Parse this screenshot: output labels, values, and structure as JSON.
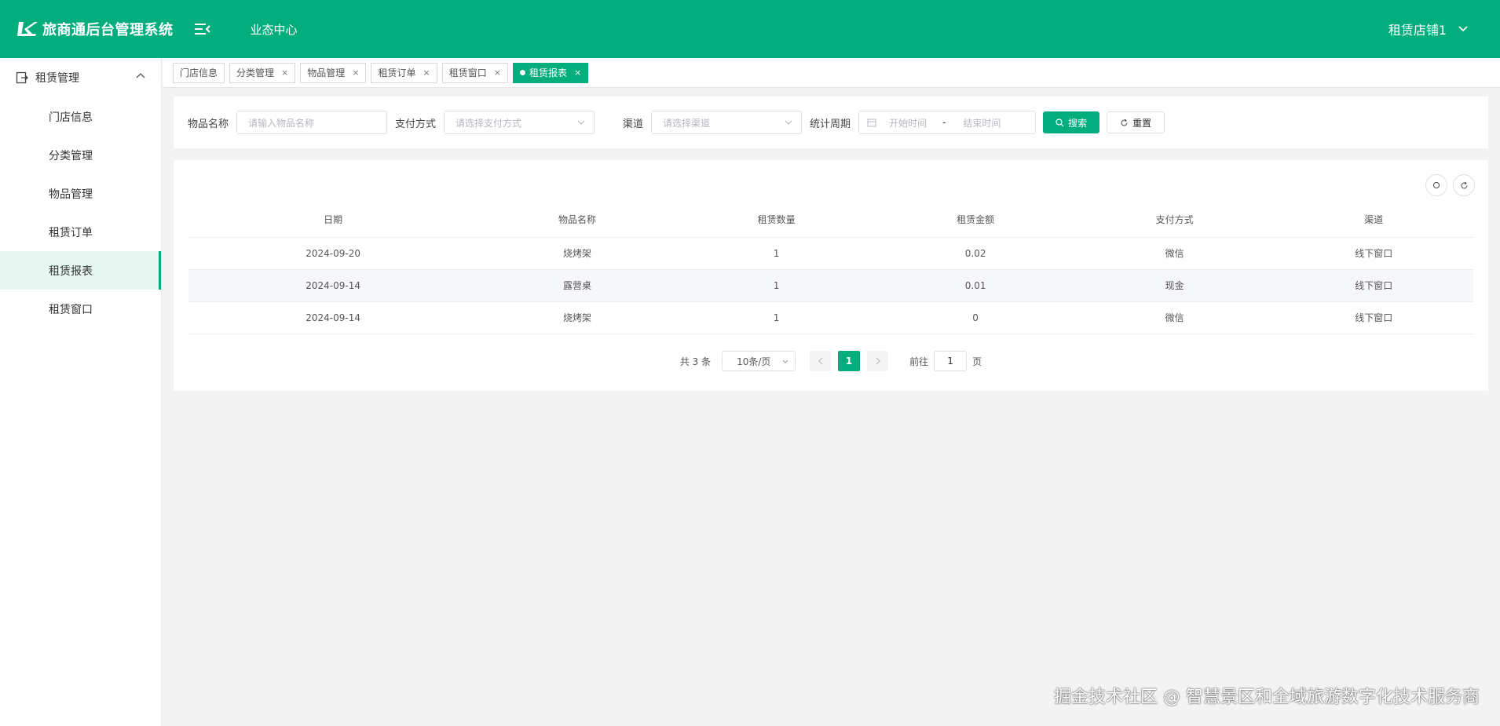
{
  "app": {
    "title": "旅商通后台管理系统",
    "nav_center": "业态中心",
    "user": "租赁店铺1"
  },
  "sidebar": {
    "group": "租赁管理",
    "items": [
      {
        "label": "门店信息"
      },
      {
        "label": "分类管理"
      },
      {
        "label": "物品管理"
      },
      {
        "label": "租赁订单"
      },
      {
        "label": "租赁报表"
      },
      {
        "label": "租赁窗口"
      }
    ]
  },
  "tabs": [
    {
      "label": "门店信息"
    },
    {
      "label": "分类管理"
    },
    {
      "label": "物品管理"
    },
    {
      "label": "租赁订单"
    },
    {
      "label": "租赁窗口"
    },
    {
      "label": "租赁报表"
    }
  ],
  "tab_close": "×",
  "search": {
    "item_name_label": "物品名称",
    "item_name_placeholder": "请输入物品名称",
    "pay_label": "支付方式",
    "pay_placeholder": "请选择支付方式",
    "channel_label": "渠道",
    "channel_placeholder": "请选择渠道",
    "period_label": "统计周期",
    "start_placeholder": "开始时间",
    "range_sep": "-",
    "end_placeholder": "结束时间",
    "search_button": "搜索",
    "reset_button": "重置"
  },
  "table": {
    "columns": [
      "日期",
      "物品名称",
      "租赁数量",
      "租赁金额",
      "支付方式",
      "渠道"
    ],
    "rows": [
      [
        "2024-09-20",
        "烧烤架",
        "1",
        "0.02",
        "微信",
        "线下窗口"
      ],
      [
        "2024-09-14",
        "露营桌",
        "1",
        "0.01",
        "现金",
        "线下窗口"
      ],
      [
        "2024-09-14",
        "烧烤架",
        "1",
        "0",
        "微信",
        "线下窗口"
      ]
    ]
  },
  "pagination": {
    "total": "共 3 条",
    "page_size": "10条/页",
    "current_page": "1",
    "goto_prefix": "前往",
    "goto_value": "1",
    "goto_suffix": "页"
  },
  "watermark": "掘金技术社区 @ 智慧景区和全域旅游数字化技术服务商",
  "colors": {
    "brand": "#04ad7e",
    "active_bg": "#e6f7f1"
  },
  "icons": [
    "logo-icon",
    "menu-fold-icon",
    "chevron-down-icon",
    "exit-icon",
    "chevron-up-icon",
    "calendar-icon",
    "search-icon",
    "refresh-icon",
    "chevron-left-icon",
    "chevron-right-icon"
  ]
}
